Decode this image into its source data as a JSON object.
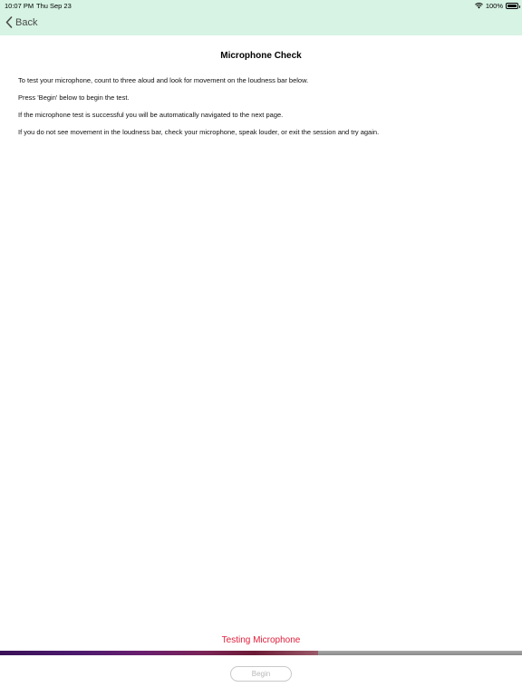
{
  "status_bar": {
    "time": "10:07 PM",
    "date": "Thu Sep 23",
    "battery": "100%",
    "wifi_icon": "wifi-icon",
    "battery_icon": "battery-icon"
  },
  "nav": {
    "back_label": "Back",
    "back_icon": "chevron-left-icon"
  },
  "page": {
    "title": "Microphone Check",
    "paragraphs": [
      "To test your microphone, count to three aloud and look for movement on the loudness bar below.",
      "Press 'Begin' below to begin the test.",
      "If the microphone test is successful you will be automatically navigated to the next page.",
      "If you do not see movement in the loudness bar, check your microphone, speak louder, or exit the session and try again."
    ]
  },
  "mic_test": {
    "status": "Testing Microphone",
    "loudness_level": 0.61
  },
  "begin_button": {
    "label": "Begin",
    "enabled": false
  },
  "colors": {
    "header_bg": "#d6f3e3",
    "status_text": "#e0203c",
    "button_disabled_text": "#b8b8b8"
  }
}
